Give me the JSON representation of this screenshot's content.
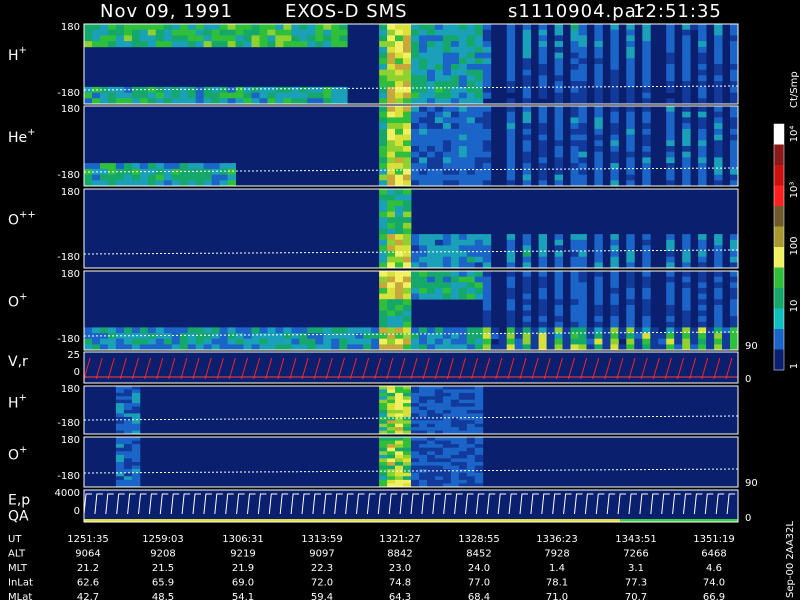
{
  "header": {
    "date": "Nov 09, 1991",
    "mission": "EXOS-D SMS",
    "file": "s1110904.par",
    "time": "12:51:35"
  },
  "chart_data": {
    "type": "heatmap",
    "panels": [
      {
        "id": "h1",
        "label": "H",
        "sup": "+",
        "ytop": "180",
        "ybot": "-180",
        "right_tick": ""
      },
      {
        "id": "he",
        "label": "He",
        "sup": "+",
        "ytop": "180",
        "ybot": "-180",
        "right_tick": ""
      },
      {
        "id": "opp",
        "label": "O",
        "sup": "++",
        "ytop": "180",
        "ybot": "-180",
        "right_tick": ""
      },
      {
        "id": "o1",
        "label": "O",
        "sup": "+",
        "ytop": "180",
        "ybot": "-180",
        "right_tick": "90"
      },
      {
        "id": "vr",
        "label": "V,r",
        "sup": "",
        "ytop": "25",
        "ybot": "0",
        "right_tick": "0"
      },
      {
        "id": "h2",
        "label": "H",
        "sup": "+",
        "ytop": "180",
        "ybot": "-180",
        "right_tick": ""
      },
      {
        "id": "o2",
        "label": "O",
        "sup": "+",
        "ytop": "180",
        "ybot": "-180",
        "right_tick": "90"
      },
      {
        "id": "ep",
        "label": "E,p",
        "label2": "QA",
        "sup": "",
        "ytop": "4000",
        "ybot": "0",
        "right_tick": "0"
      }
    ],
    "colorbar": {
      "unit": "Ct/Smp",
      "ticks": [
        "10⁴",
        "10³",
        "100",
        "10",
        "1"
      ]
    },
    "side_note": "Sep-00 2AA32L",
    "table": {
      "rows": [
        {
          "name": "UT",
          "values": [
            "1251:35",
            "1259:03",
            "1306:31",
            "1313:59",
            "1321:27",
            "1328:55",
            "1336:23",
            "1343:51",
            "1351:19"
          ]
        },
        {
          "name": "ALT",
          "values": [
            "9064",
            "9208",
            "9219",
            "9097",
            "8842",
            "8452",
            "7928",
            "7266",
            "6468"
          ]
        },
        {
          "name": "MLT",
          "values": [
            "21.2",
            "21.5",
            "21.9",
            "22.3",
            "23.0",
            "24.0",
            "1.4",
            "3.1",
            "4.6"
          ]
        },
        {
          "name": "InLat",
          "values": [
            "62.6",
            "65.9",
            "69.0",
            "72.0",
            "74.8",
            "77.0",
            "78.1",
            "77.3",
            "74.0"
          ]
        },
        {
          "name": "MLat",
          "values": [
            "42.7",
            "48.5",
            "54.1",
            "59.4",
            "64.3",
            "68.4",
            "71.0",
            "70.7",
            "66.9"
          ]
        }
      ]
    }
  }
}
